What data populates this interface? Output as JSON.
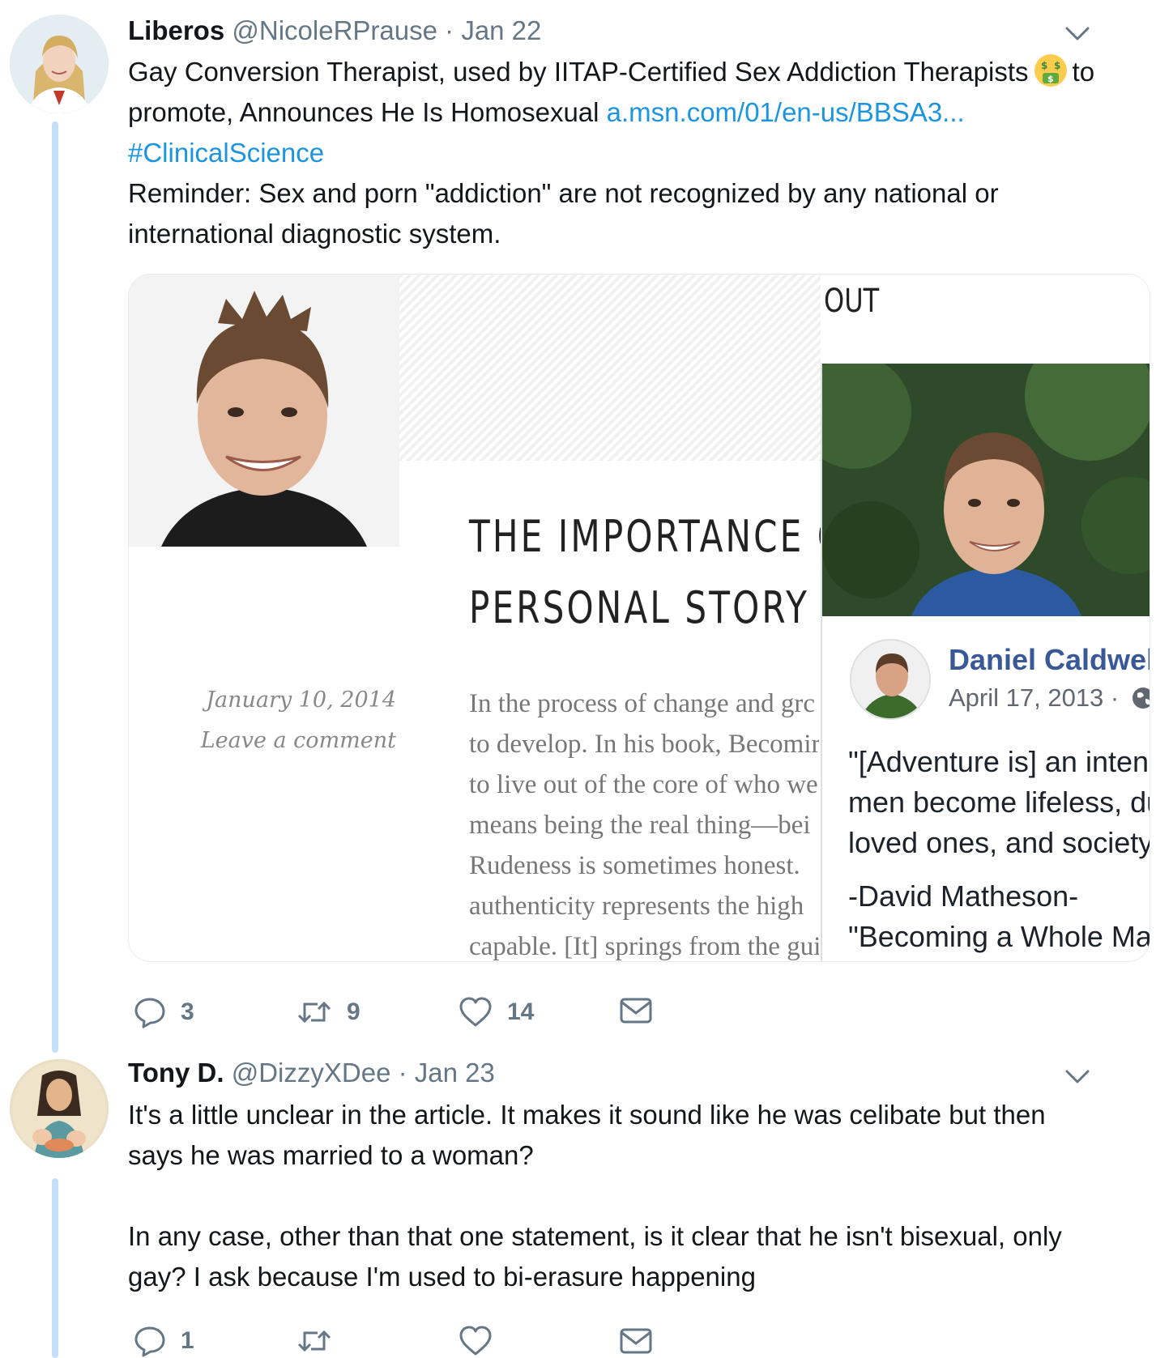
{
  "tweets": [
    {
      "author_name": "Liberos",
      "handle": "@NicoleRPrause",
      "date": "Jan 22",
      "text_part1": "Gay Conversion Therapist, used by IITAP-Certified Sex Addiction Therapists",
      "text_part2": "to",
      "text_part3": "promote, Announces He Is Homosexual",
      "link": "a.msn.com/01/en-us/BBSA3...",
      "hashtag": "#ClinicalScience",
      "text_part4": "Reminder: Sex and porn \"addiction\" are not recognized by any national or",
      "text_part5": "international diagnostic system.",
      "emoji": "money-mouth-face",
      "replies": "3",
      "retweets": "9",
      "likes": "14"
    },
    {
      "author_name": "Tony D.",
      "handle": "@DizzyXDee",
      "date": "Jan 23",
      "line1": "It's a little unclear in the article. It makes it sound like he was celibate but then",
      "line2": "says he was married to a woman?",
      "line3": "In any case, other than that one statement, is it clear that he isn't bisexual, only",
      "line4": "gay? I ask because I'm used to bi-erasure happening",
      "replies": "1",
      "retweets": "",
      "likes": ""
    }
  ],
  "media": {
    "blog": {
      "header_out": "OUT",
      "title_line1": "THE IMPORTANCE OF",
      "title_line2": "PERSONAL STORY",
      "post_date": "January 10, 2014",
      "comment_link": "Leave a comment",
      "body_lines": [
        "In the process of change and grc",
        "to develop. In his book, Becomir",
        "to live out of the core of who we",
        "means being the real thing—bei",
        "Rudeness is sometimes honest.",
        "authenticity represents the high",
        "capable. [It] springs from the gui"
      ]
    },
    "facebook": {
      "name": "Daniel Caldwell",
      "date": "April 17, 2013 ·",
      "quote_lines": [
        "\"[Adventure is] an intens",
        "men become lifeless, du",
        "loved ones, and society."
      ],
      "attribution": "-David Matheson-",
      "book": "\"Becoming a Whole Mar"
    }
  },
  "colors": {
    "link": "#1b95e0",
    "meta": "#657786",
    "thread_line": "#c4e0f9",
    "fb_name": "#385898"
  }
}
